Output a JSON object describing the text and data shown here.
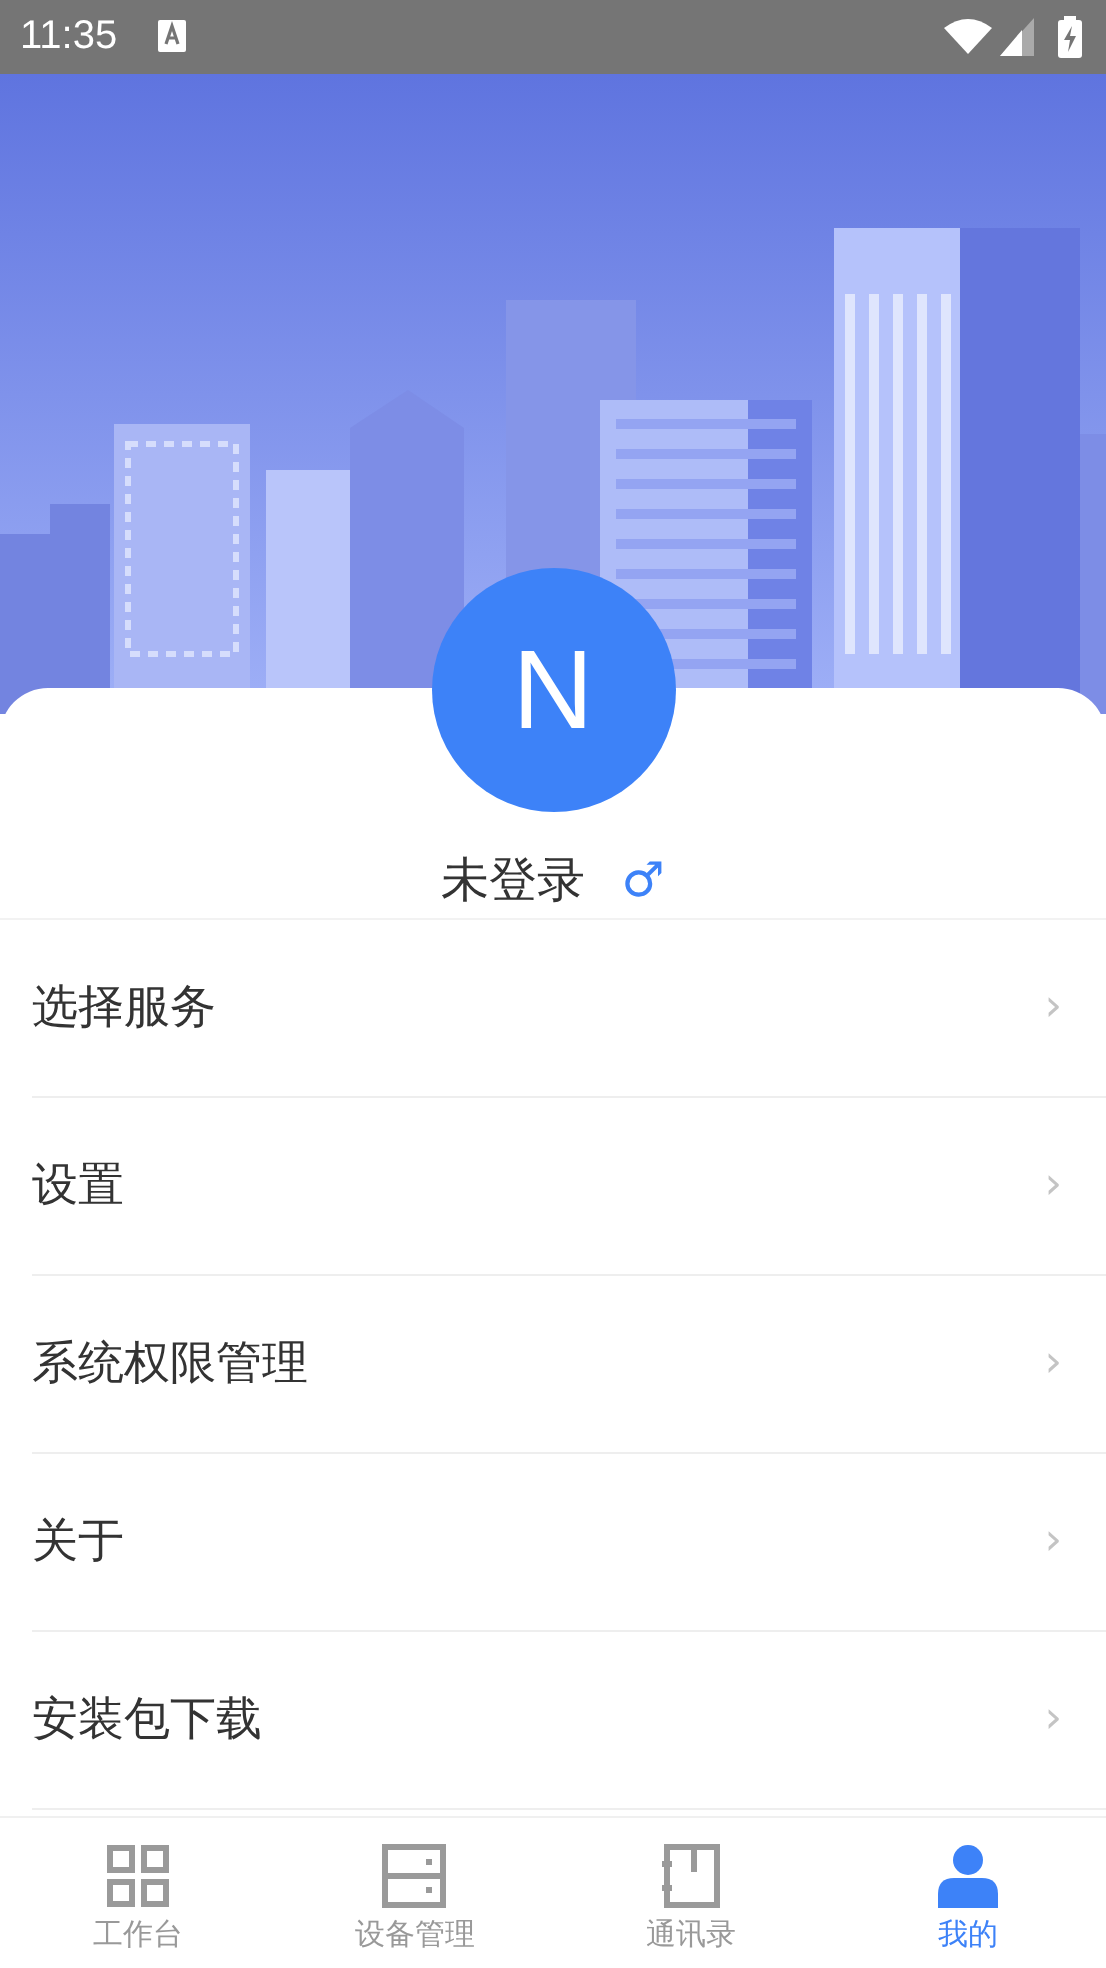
{
  "status_bar": {
    "time": "11:35"
  },
  "profile": {
    "avatar_letter": "N",
    "name": "未登录",
    "gender_symbol": "♂"
  },
  "menu": [
    {
      "label": "选择服务",
      "chevron": "›"
    },
    {
      "label": "设置",
      "chevron": "›"
    },
    {
      "label": "系统权限管理",
      "chevron": "›"
    },
    {
      "label": "关于",
      "chevron": "›"
    },
    {
      "label": "安装包下载",
      "chevron": "›"
    }
  ],
  "tab_bar": [
    {
      "label": "工作台",
      "kind": "grid",
      "selected": false
    },
    {
      "label": "设备管理",
      "kind": "cabinet",
      "selected": false
    },
    {
      "label": "通讯录",
      "kind": "book",
      "selected": false
    },
    {
      "label": "我的",
      "kind": "person",
      "selected": true
    }
  ]
}
